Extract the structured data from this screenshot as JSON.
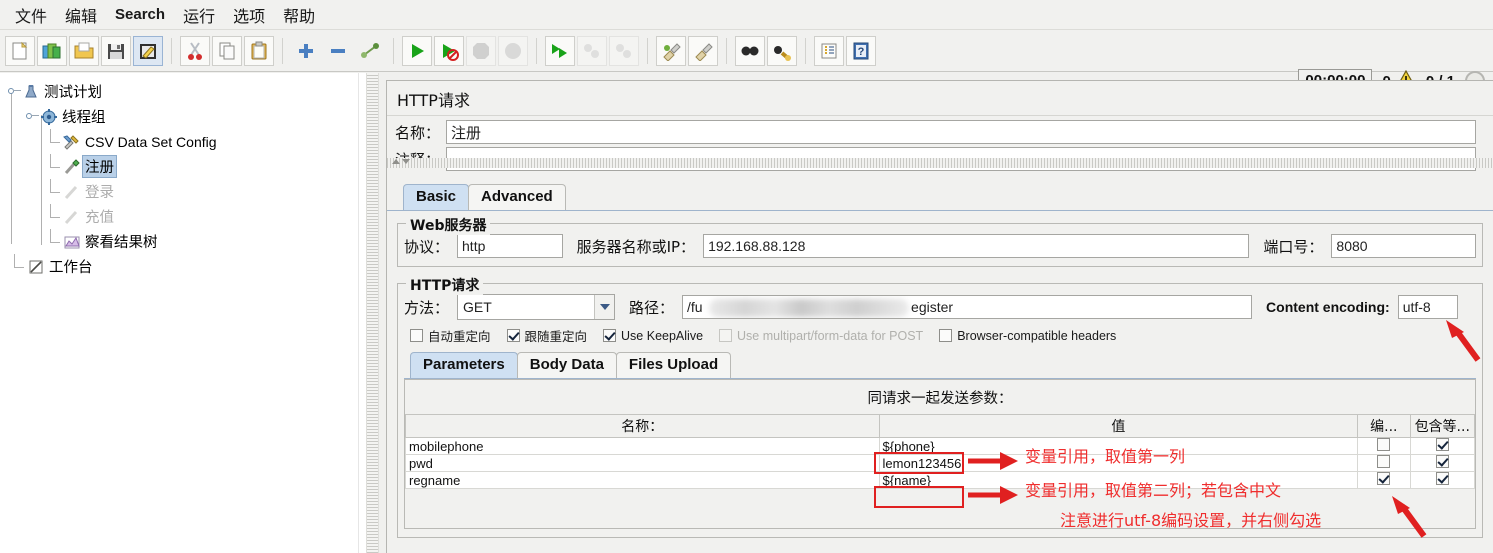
{
  "menu": {
    "items": [
      {
        "label": "文件",
        "cjk": true
      },
      {
        "label": "编辑",
        "cjk": true
      },
      {
        "label": "Search",
        "cjk": false
      },
      {
        "label": "运行",
        "cjk": true
      },
      {
        "label": "选项",
        "cjk": true
      },
      {
        "label": "帮助",
        "cjk": true
      }
    ]
  },
  "toolbar": {
    "icons": [
      "new-icon",
      "templates-icon",
      "open-icon",
      "save-icon",
      "edit-icon",
      "cut-icon",
      "copy-icon",
      "paste-icon",
      "expand-icon",
      "collapse-icon",
      "toggle-icon",
      "start-icon",
      "start-no-pauses-icon",
      "stop-icon",
      "shutdown-icon",
      "remote-start-all-icon",
      "remote-stop-all-icon",
      "remote-shutdown-all-icon",
      "clear-icon",
      "clear-all-icon",
      "search-icon",
      "search-reset-icon",
      "function-helper-icon",
      "help-icon"
    ],
    "status": {
      "timer": "00:00:00",
      "warning_count": "0",
      "warning_icon": "warning-triangle-icon",
      "thread_ratio": "0 / 1",
      "stop_icon": "activity-circle-icon"
    }
  },
  "tree": {
    "nodes": [
      {
        "label": "测试计划",
        "icon": "test-plan-icon",
        "depth": 0,
        "state": "normal"
      },
      {
        "label": "线程组",
        "icon": "thread-group-icon",
        "depth": 1,
        "state": "normal"
      },
      {
        "label": "CSV Data Set Config",
        "icon": "config-element-icon",
        "depth": 2,
        "state": "normal",
        "latin": true
      },
      {
        "label": "注册",
        "icon": "http-sampler-icon",
        "depth": 2,
        "state": "selected"
      },
      {
        "label": "登录",
        "icon": "http-sampler-disabled-icon",
        "depth": 2,
        "state": "disabled"
      },
      {
        "label": "充值",
        "icon": "http-sampler-disabled-icon",
        "depth": 2,
        "state": "disabled"
      },
      {
        "label": "察看结果树",
        "icon": "view-results-tree-icon",
        "depth": 2,
        "state": "normal"
      },
      {
        "label": "工作台",
        "icon": "workbench-icon",
        "depth": 0,
        "state": "normal"
      }
    ]
  },
  "panel": {
    "title": "HTTP请求",
    "name_label": "名称：",
    "name_value": "注册",
    "comment_label": "注释：",
    "comment_value": "",
    "tabs": [
      {
        "label": "Basic",
        "selected": true
      },
      {
        "label": "Advanced",
        "selected": false
      }
    ],
    "web_server": {
      "title": "Web服务器",
      "protocol_label": "协议：",
      "protocol_value": "http",
      "server_label": "服务器名称或IP：",
      "server_value": "192.168.88.128",
      "port_label": "端口号：",
      "port_value": "8080"
    },
    "http_request": {
      "title": "HTTP请求",
      "method_label": "方法：",
      "method_value": "GET",
      "path_label": "路径：",
      "path_value_prefix": "/fu",
      "path_value_suffix": "egister",
      "content_encoding_label": "Content encoding:",
      "content_encoding_value": "utf-8",
      "checkboxes": [
        {
          "label": "自动重定向",
          "checked": false,
          "enabled": true,
          "cjk": true
        },
        {
          "label": "跟随重定向",
          "checked": true,
          "enabled": true,
          "cjk": true
        },
        {
          "label": "Use KeepAlive",
          "checked": true,
          "enabled": true,
          "cjk": false
        },
        {
          "label": "Use multipart/form-data for POST",
          "checked": false,
          "enabled": false,
          "cjk": false
        },
        {
          "label": "Browser-compatible headers",
          "checked": false,
          "enabled": true,
          "cjk": false
        }
      ]
    },
    "param_tabs": [
      {
        "label": "Parameters",
        "selected": true
      },
      {
        "label": "Body Data",
        "selected": false
      },
      {
        "label": "Files Upload",
        "selected": false
      }
    ],
    "parameters": {
      "caption": "同请求一起发送参数：",
      "columns": [
        "名称：",
        "值",
        "编...",
        "包含等..."
      ],
      "rows": [
        {
          "name": "mobilephone",
          "value": "${phone}",
          "encode": false,
          "include_equals": true
        },
        {
          "name": "pwd",
          "value": "lemon123456",
          "encode": false,
          "include_equals": true
        },
        {
          "name": "regname",
          "value": "${name}",
          "encode": true,
          "include_equals": true
        }
      ]
    }
  },
  "annotations": {
    "note1": "变量引用，取值第一列",
    "note2": "变量引用，取值第二列；若包含中文",
    "note3": "注意进行utf-8编码设置，并右侧勾选",
    "color": "#ef2d2d"
  }
}
